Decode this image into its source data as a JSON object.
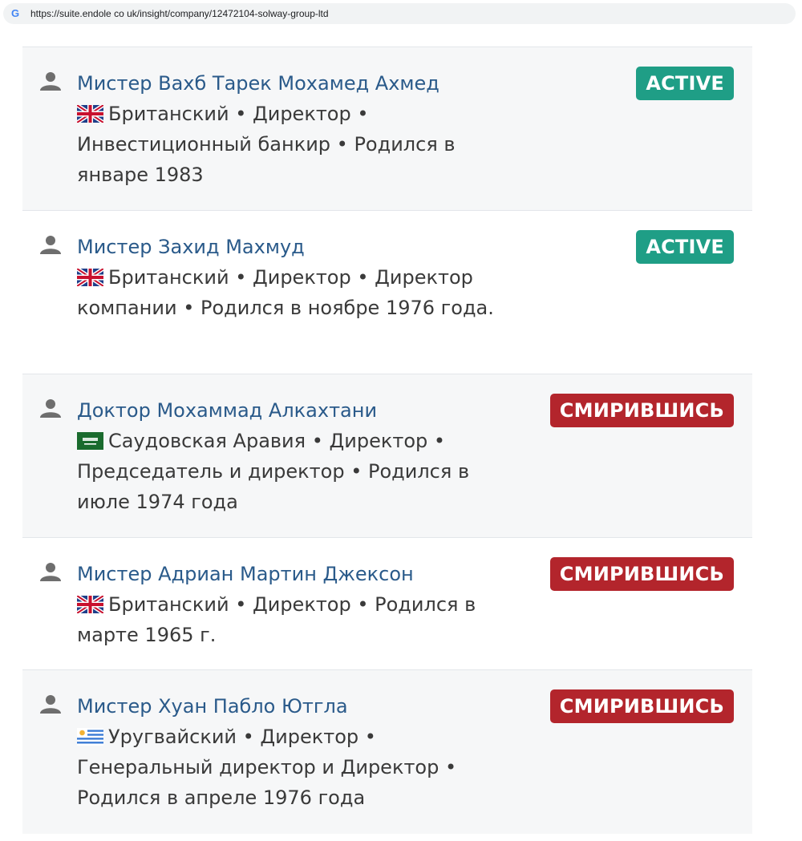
{
  "browser": {
    "favicon_letter": "G",
    "url": "https://suite.endole co uk/insight/company/12472104-solway-group-ltd"
  },
  "colors": {
    "active": "#1f9e86",
    "resigned": "#b3252c",
    "name_link": "#2a5a8a",
    "detail_text": "#3a3a3a"
  },
  "officers": [
    {
      "name": "Мистер Вахб Тарек Мохамед Ахмед",
      "flag": "uk-flag-icon",
      "details": "Британский • Директор • Инвестиционный банкир • Родился в январе 1983",
      "status": "ACTIVE",
      "status_type": "active"
    },
    {
      "name": "Мистер Захид Махмуд",
      "flag": "uk-flag-icon",
      "details": "Британский • Директор • Директор компании • Родился в ноябре 1976 года.",
      "status": "ACTIVE",
      "status_type": "active"
    },
    {
      "name": "Доктор Мохаммад Алкахтани",
      "flag": "saudi-flag-icon",
      "details": "Саудовская Аравия • Директор • Председатель и директор • Родился в июле 1974 года",
      "status": "СМИРИВШИСЬ",
      "status_type": "resigned"
    },
    {
      "name": "Мистер Адриан Мартин Джексон",
      "flag": "uk-flag-icon",
      "details": "Британский • Директор • Родился в марте 1965 г.",
      "status": "СМИРИВШИСЬ",
      "status_type": "resigned"
    },
    {
      "name": "Мистер Хуан Пабло Ютгла",
      "flag": "uruguay-flag-icon",
      "details": "Уругвайский • Директор • Генеральный директор и Директор • Родился в апреле 1976 года",
      "status": "СМИРИВШИСЬ",
      "status_type": "resigned"
    }
  ]
}
